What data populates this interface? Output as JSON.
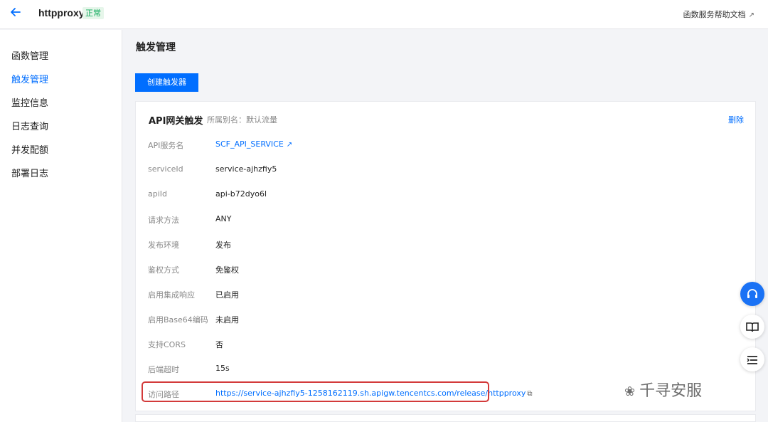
{
  "header": {
    "app_title": "httpproxy",
    "status": "正常",
    "help_link": "函数服务帮助文档"
  },
  "sidebar": {
    "items": [
      {
        "label": "函数管理"
      },
      {
        "label": "触发管理"
      },
      {
        "label": "监控信息"
      },
      {
        "label": "日志查询"
      },
      {
        "label": "并发配额"
      },
      {
        "label": "部署日志"
      }
    ]
  },
  "main": {
    "title": "触发管理",
    "create_button": "创建触发器"
  },
  "trigger": {
    "title": "API网关触发",
    "alias": "所属别名：默认流量",
    "delete_label": "删除",
    "rows": [
      {
        "label": "API服务名",
        "value": "SCF_API_SERVICE"
      },
      {
        "label": "serviceId",
        "value": "service-ajhzfiy5"
      },
      {
        "label": "apiId",
        "value": "api-b72dyo6l"
      },
      {
        "label": "请求方法",
        "value": "ANY"
      },
      {
        "label": "发布环境",
        "value": "发布"
      },
      {
        "label": "鉴权方式",
        "value": "免鉴权"
      },
      {
        "label": "启用集成响应",
        "value": "已启用"
      },
      {
        "label": "启用Base64编码",
        "value": "未启用"
      },
      {
        "label": "支持CORS",
        "value": "否"
      },
      {
        "label": "后端超时",
        "value": "15s"
      },
      {
        "label": "访问路径",
        "value": "https://service-ajhzfiy5-1258162119.sh.apigw.tencentcs.com/release/httpproxy"
      }
    ]
  },
  "floating": {
    "support_icon": "headset-icon",
    "docs_icon": "book-icon",
    "list_icon": "list-icon"
  },
  "watermark": {
    "text": "千寻安服"
  },
  "colors": {
    "accent": "#006eff",
    "status_green": "#0aa858",
    "highlight_red": "#d33a3a"
  }
}
